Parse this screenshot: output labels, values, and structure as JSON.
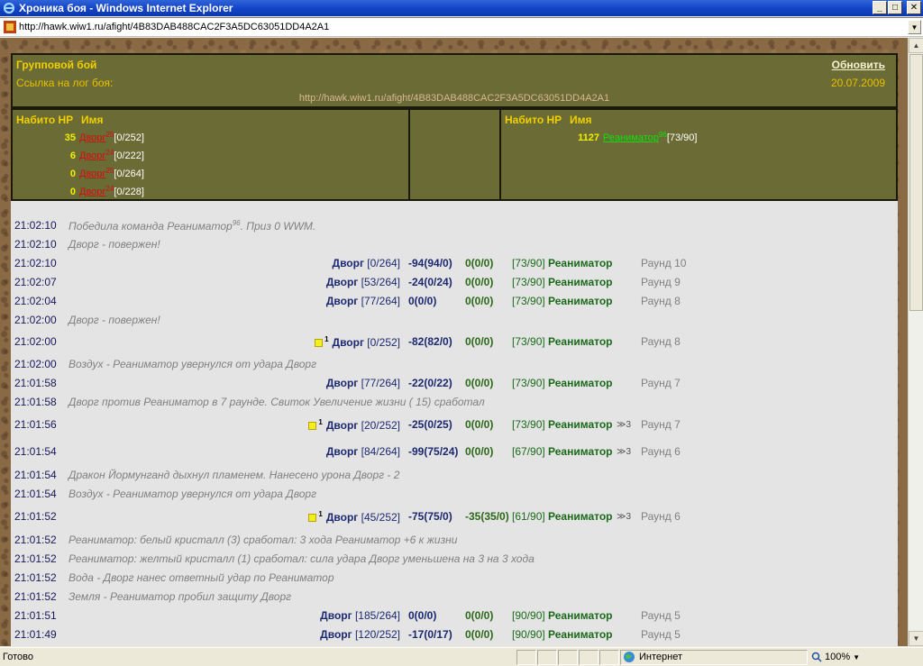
{
  "window": {
    "title": "Хроника боя - Windows Internet Explorer",
    "minimize": "_",
    "maximize": "□",
    "close": "✕"
  },
  "address": {
    "url": "http://hawk.wiw1.ru/afight/4B83DAB488CAC2F3A5DC63051DD4A2A1"
  },
  "header": {
    "fight_type": "Групповой бой",
    "refresh_label": "Обновить",
    "log_label": "Ссылка на лог боя:",
    "date": "20.07.2009",
    "log_url": "http://hawk.wiw1.ru/afight/4B83DAB488CAC2F3A5DC63051DD4A2A1"
  },
  "teams": {
    "left": {
      "col_hp": "Набито HP",
      "col_name": "Имя",
      "color": "#d01010",
      "members": [
        {
          "hp": "35",
          "name": "Дворг",
          "level": "25",
          "stat": "[0/252]"
        },
        {
          "hp": "6",
          "name": "Дворг",
          "level": "24",
          "stat": "[0/222]"
        },
        {
          "hp": "0",
          "name": "Дворг",
          "level": "25",
          "stat": "[0/264]"
        },
        {
          "hp": "0",
          "name": "Дворг",
          "level": "24",
          "stat": "[0/228]"
        }
      ]
    },
    "right": {
      "col_hp": "Набито HP",
      "col_name": "Имя",
      "color": "#10e010",
      "members": [
        {
          "hp": "1127",
          "name": "Реаниматор",
          "level": "96",
          "stat": "[73/90]"
        }
      ]
    }
  },
  "log": [
    {
      "time": "21:02:10",
      "kind": "msg",
      "text": "Победила команда Реаниматор",
      "sup": "96",
      "tail": ". Приз 0 WWM."
    },
    {
      "time": "21:02:10",
      "kind": "msg",
      "text": "Дворг - повержен!"
    },
    {
      "time": "21:02:10",
      "kind": "hit",
      "atk": "Дворг",
      "atk_hp": "[0/264]",
      "d1": "-94(94/0)",
      "d2": "0(0/0)",
      "def_hp": "[73/90]",
      "def": "Реаниматор",
      "round": "Раунд 10"
    },
    {
      "time": "21:02:07",
      "kind": "hit",
      "atk": "Дворг",
      "atk_hp": "[53/264]",
      "d1": "-24(0/24)",
      "d2": "0(0/0)",
      "def_hp": "[73/90]",
      "def": "Реаниматор",
      "round": "Раунд 9"
    },
    {
      "time": "21:02:04",
      "kind": "hit",
      "atk": "Дворг",
      "atk_hp": "[77/264]",
      "d1": "0(0/0)",
      "d2": "0(0/0)",
      "def_hp": "[73/90]",
      "def": "Реаниматор",
      "round": "Раунд 8"
    },
    {
      "time": "21:02:00",
      "kind": "msg",
      "text": "Дворг - повержен!"
    },
    {
      "time": "21:02:00",
      "kind": "hit",
      "scroll": "1",
      "atk": "Дворг",
      "atk_hp": "[0/252]",
      "d1": "-82(82/0)",
      "d2": "0(0/0)",
      "def_hp": "[73/90]",
      "def": "Реаниматор",
      "round": "Раунд 8"
    },
    {
      "time": "21:02:00",
      "kind": "msg",
      "text": "Воздух - Реаниматор увернулся от удара Дворг"
    },
    {
      "time": "21:01:58",
      "kind": "hit",
      "atk": "Дворг",
      "atk_hp": "[77/264]",
      "d1": "-22(0/22)",
      "d2": "0(0/0)",
      "def_hp": "[73/90]",
      "def": "Реаниматор",
      "round": "Раунд 7"
    },
    {
      "time": "21:01:58",
      "kind": "msg",
      "text": "Дворг против Реаниматор в 7 раунде. Свиток Увеличение жизни ( 15) сработал"
    },
    {
      "time": "21:01:56",
      "kind": "hit",
      "scroll": "1",
      "atk": "Дворг",
      "atk_hp": "[20/252]",
      "d1": "-25(0/25)",
      "d2": "0(0/0)",
      "def_hp": "[73/90]",
      "def": "Реаниматор",
      "fx": "≫3",
      "round": "Раунд 7"
    },
    {
      "time": "21:01:54",
      "kind": "hit",
      "atk": "Дворг",
      "atk_hp": "[84/264]",
      "d1": "-99(75/24)",
      "d2": "0(0/0)",
      "def_hp": "[67/90]",
      "def": "Реаниматор",
      "fx": "≫3",
      "round": "Раунд 6"
    },
    {
      "time": "21:01:54",
      "kind": "msg",
      "text": "Дракон Йормунганд дыхнул пламенем. Нанесено урона Дворг - 2"
    },
    {
      "time": "21:01:54",
      "kind": "msg",
      "text": "Воздух - Реаниматор увернулся от удара Дворг"
    },
    {
      "time": "21:01:52",
      "kind": "hit",
      "scroll": "1",
      "atk": "Дворг",
      "atk_hp": "[45/252]",
      "d1": "-75(75/0)",
      "d2": "-35(35/0)",
      "def_hp": "[61/90]",
      "def": "Реаниматор",
      "fx": "≫3",
      "round": "Раунд 6"
    },
    {
      "time": "21:01:52",
      "kind": "msg",
      "text": "Реаниматор: белый кристалл (3) сработал: 3 хода Реаниматор +6 к жизни"
    },
    {
      "time": "21:01:52",
      "kind": "msg",
      "text": "Реаниматор: желтый кристалл (1) сработал: сила удара Дворг уменьшена на 3 на 3 хода"
    },
    {
      "time": "21:01:52",
      "kind": "msg",
      "text": "Вода - Дворг нанес ответный удар по Реаниматор"
    },
    {
      "time": "21:01:52",
      "kind": "msg",
      "text": "Земля - Реаниматор пробил защиту Дворг"
    },
    {
      "time": "21:01:51",
      "kind": "hit",
      "atk": "Дворг",
      "atk_hp": "[185/264]",
      "d1": "0(0/0)",
      "d2": "0(0/0)",
      "def_hp": "[90/90]",
      "def": "Реаниматор",
      "round": "Раунд 5"
    },
    {
      "time": "21:01:49",
      "kind": "hit",
      "atk": "Дворг",
      "atk_hp": "[120/252]",
      "d1": "-17(0/17)",
      "d2": "0(0/0)",
      "def_hp": "[90/90]",
      "def": "Реаниматор",
      "round": "Раунд 5"
    }
  ],
  "status": {
    "ready": "Готово",
    "zone": "Интернет",
    "zoom": "100%"
  }
}
